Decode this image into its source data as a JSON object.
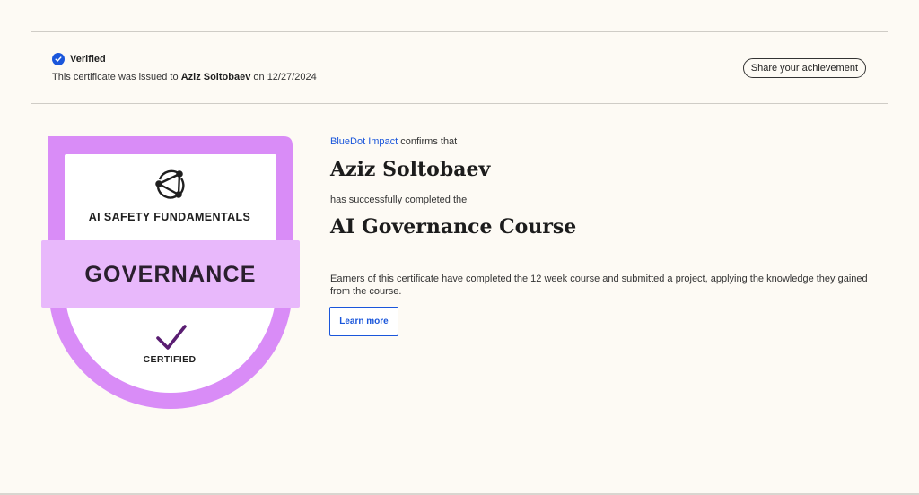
{
  "verification": {
    "status_label": "Verified",
    "text_prefix": "This certificate was issued to",
    "recipient": "Aziz Soltobaev",
    "text_on": "on",
    "date": "12/27/2024",
    "share_label": "Share your achievement"
  },
  "badge": {
    "program": "AI SAFETY FUNDAMENTALS",
    "track": "GOVERNANCE",
    "status": "CERTIFIED",
    "colors": {
      "outer": "#d98cf7",
      "ribbon": "#e8b8fb",
      "ribbon_text": "#2a1f2e",
      "check": "#5a1d72"
    }
  },
  "certificate": {
    "issuer": "BlueDot Impact",
    "issuer_suffix": "confirms that",
    "recipient_name": "Aziz Soltobaev",
    "completed_text": "has successfully completed the",
    "course_title": "AI Governance Course",
    "description": "Earners of this certificate have completed the 12 week course and submitted a project, applying the knowledge they gained from the course.",
    "learn_more_label": "Learn more"
  },
  "colors": {
    "background": "#fdfaf4",
    "accent": "#1a56db"
  }
}
